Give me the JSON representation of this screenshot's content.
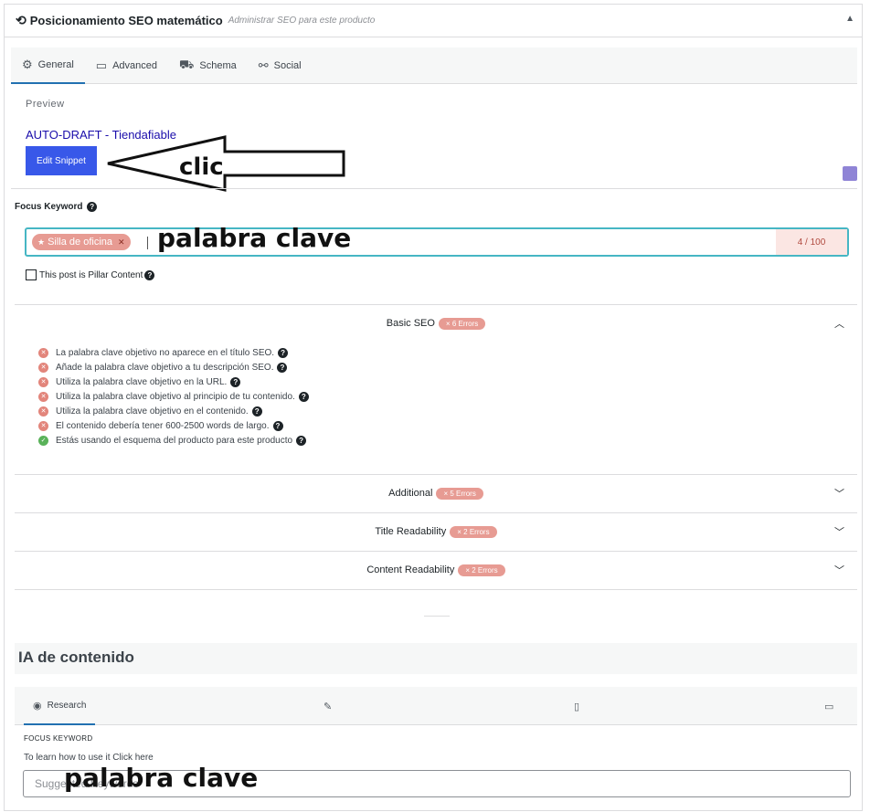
{
  "header": {
    "title": "Posicionamiento SEO matemático",
    "subtitle": "Administrar SEO para este producto"
  },
  "tabs": [
    {
      "label": "General",
      "icon": "gear-icon",
      "active": true
    },
    {
      "label": "Advanced",
      "icon": "toolbox-icon",
      "active": false
    },
    {
      "label": "Schema",
      "icon": "cart-icon",
      "active": false
    },
    {
      "label": "Social",
      "icon": "share-icon",
      "active": false
    }
  ],
  "preview": {
    "label": "Preview",
    "serp_title": "AUTO-DRAFT - Tiendafiable",
    "edit_button": "Edit Snippet"
  },
  "focus_keyword": {
    "label": "Focus Keyword",
    "tag": "Silla de oficina",
    "counter": "4 / 100"
  },
  "pillar": {
    "label": "This post is Pillar Content"
  },
  "basic_seo": {
    "title": "Basic SEO",
    "badge": "× 6 Errors",
    "checks": [
      {
        "text": "La palabra clave objetivo no aparece en el título SEO.",
        "status": "error"
      },
      {
        "text": "Añade la palabra clave objetivo a tu descripción SEO.",
        "status": "error"
      },
      {
        "text": "Utiliza la palabra clave objetivo en la URL.",
        "status": "error"
      },
      {
        "text": "Utiliza la palabra clave objetivo al principio de tu contenido.",
        "status": "error"
      },
      {
        "text": "Utiliza la palabra clave objetivo en el contenido.",
        "status": "error"
      },
      {
        "text": "El contenido debería tener 600-2500 words de largo.",
        "status": "error"
      },
      {
        "text": "Estás usando el esquema del producto para este producto",
        "status": "ok"
      }
    ]
  },
  "sections": [
    {
      "title": "Additional",
      "badge": "× 5 Errors"
    },
    {
      "title": "Title Readability",
      "badge": "× 2 Errors"
    },
    {
      "title": "Content Readability",
      "badge": "× 2 Errors"
    }
  ],
  "ai": {
    "title": "IA de contenido",
    "tab_research": "Research",
    "fk_label": "FOCUS KEYWORD",
    "help_text": "To learn how to use it Click here",
    "input_placeholder": "Suggested Keywords"
  },
  "annotations": {
    "clic": "clic",
    "kw1": "palabra clave",
    "kw2": "palabra clave"
  },
  "colors": {
    "accent": "#2271b1",
    "button": "#3858e9",
    "error_badge": "#e79b93",
    "input_border": "#46b6c4",
    "ok": "#59b259"
  }
}
